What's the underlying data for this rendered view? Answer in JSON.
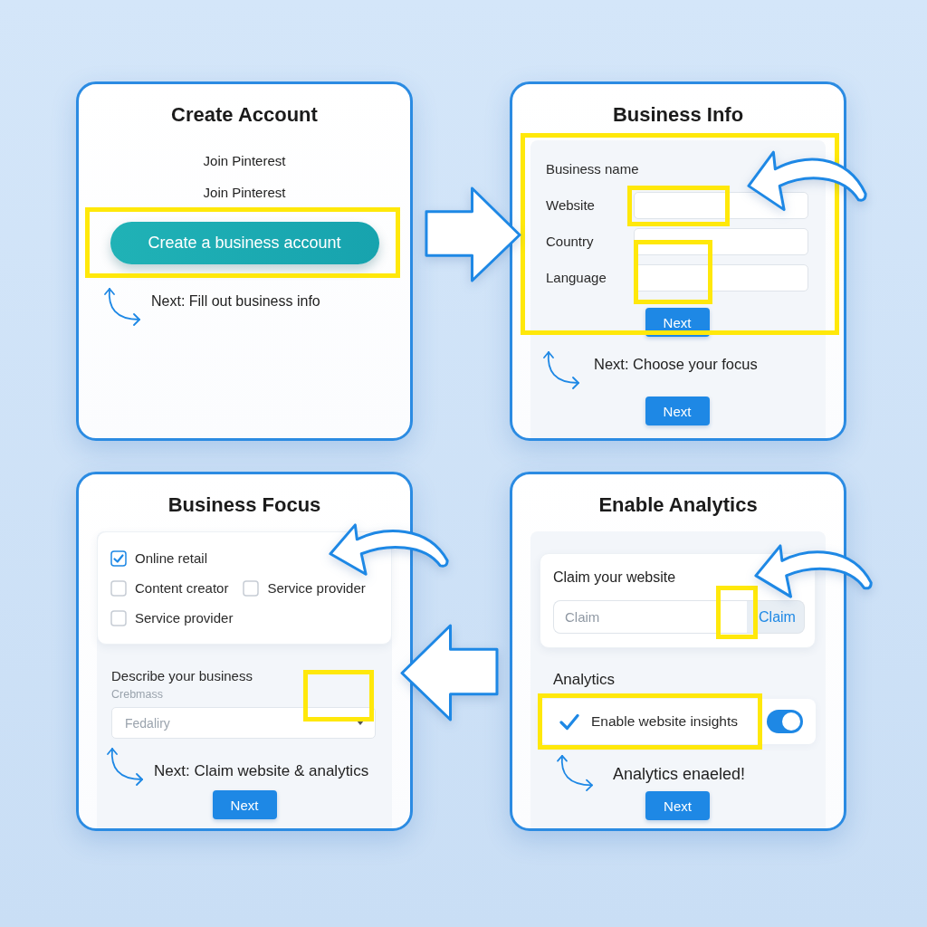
{
  "create_account": {
    "title": "Create Account",
    "lines": [
      "Join Pinterest",
      "Join Pinterest"
    ],
    "button": "Create a business account",
    "next_hint": "Next: Fill out business info"
  },
  "business_info": {
    "title": "Business Info",
    "fields": [
      {
        "label": "Business name",
        "kind": "label"
      },
      {
        "label": "Website",
        "kind": "input"
      },
      {
        "label": "Country",
        "kind": "input"
      },
      {
        "label": "Language",
        "kind": "input"
      }
    ],
    "form_button": "Next",
    "next_hint": "Next: Choose your focus",
    "button": "Next"
  },
  "business_focus": {
    "title": "Business Focus",
    "option_rows": [
      [
        {
          "label": "Online retail",
          "checked": true
        }
      ],
      [
        {
          "label": "Content creator",
          "checked": false
        },
        {
          "label": "Service provider",
          "checked": false
        }
      ],
      [
        {
          "label": "Service provider",
          "checked": false
        }
      ]
    ],
    "describe": {
      "label": "Describe your business",
      "hint": "Crebmass",
      "placeholder": "Fedaliry"
    },
    "next_hint": "Next: Claim website & analytics",
    "button": "Next"
  },
  "enable_analytics": {
    "title": "Enable Analytics",
    "claim": {
      "label": "Claim your website",
      "placeholder": "Claim",
      "button": "Claim"
    },
    "section_title": "Analytics",
    "insights": {
      "label": "Enable website insights",
      "checked": true,
      "on": true
    },
    "status": "Analytics enaeled!",
    "button": "Next"
  }
}
